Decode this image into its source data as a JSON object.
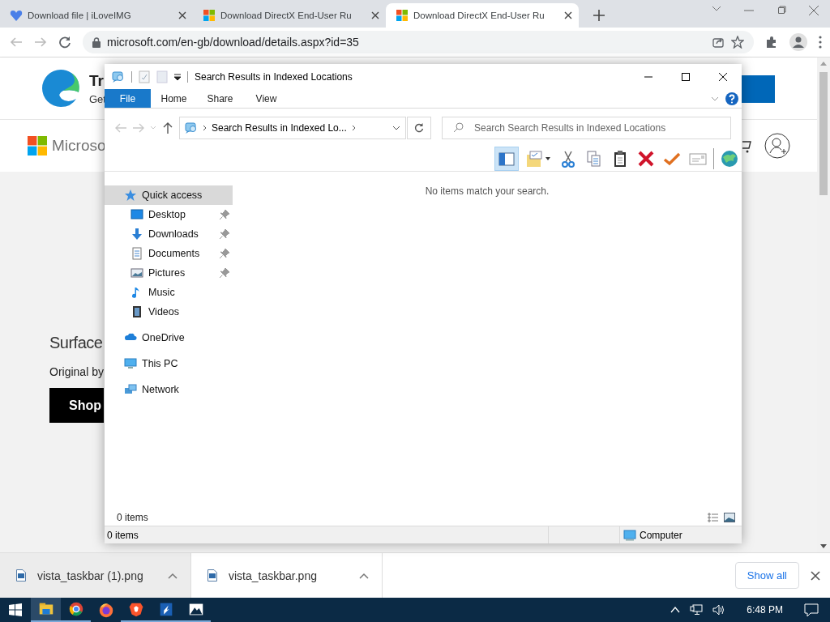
{
  "browser": {
    "tabs": [
      {
        "title": "Download file | iLoveIMG",
        "selected": false
      },
      {
        "title": "Download DirectX End-User Ru",
        "selected": false
      },
      {
        "title": "Download DirectX End-User Ru",
        "selected": true
      }
    ],
    "url": "microsoft.com/en-gb/download/details.aspx?id=35"
  },
  "web_page": {
    "promo_title": "Tr",
    "promo_text": "Get",
    "brand": "Microso",
    "hero_title": "Surface",
    "hero_text": "Original by",
    "hero_button": "Shop"
  },
  "explorer": {
    "title": "Search Results in Indexed Locations",
    "ribbon_tabs": [
      {
        "label": "File",
        "selected": true
      },
      {
        "label": "Home",
        "selected": false
      },
      {
        "label": "Share",
        "selected": false
      },
      {
        "label": "View",
        "selected": false
      }
    ],
    "address": "Search Results in Indexed Lo...",
    "search": {
      "placeholder": "Search Search Results in Indexed Locations"
    },
    "toolbar": {
      "pane_toggle_on": true
    },
    "nav_pane": [
      {
        "label": "Quick access",
        "selected": true,
        "children": [
          {
            "label": "Desktop",
            "selected": false,
            "pinned": true
          },
          {
            "label": "Downloads",
            "selected": false,
            "pinned": true
          },
          {
            "label": "Documents",
            "selected": false,
            "pinned": true
          },
          {
            "label": "Pictures",
            "selected": false,
            "pinned": true
          },
          {
            "label": "Music",
            "selected": false,
            "pinned": false
          },
          {
            "label": "Videos",
            "selected": false,
            "pinned": false
          }
        ]
      },
      {
        "label": "OneDrive",
        "selected": false
      },
      {
        "label": "This PC",
        "selected": false
      },
      {
        "label": "Network",
        "selected": false
      }
    ],
    "empty_message": "No items match your search.",
    "item_count": "0 items",
    "status_bar": {
      "count": "0 items",
      "location": "Computer"
    }
  },
  "downloads": {
    "items": [
      {
        "filename": "vista_taskbar (1).png",
        "selected": true
      },
      {
        "filename": "vista_taskbar.png",
        "selected": false
      }
    ],
    "show_all": "Show all"
  },
  "taskbar": {
    "apps": [
      {
        "selected": true,
        "running": true
      },
      {
        "selected": false,
        "running": true
      },
      {
        "selected": false,
        "running": false
      },
      {
        "selected": false,
        "running": true
      },
      {
        "selected": false,
        "running": true
      },
      {
        "selected": false,
        "running": true
      }
    ],
    "clock": "6:48 PM"
  }
}
